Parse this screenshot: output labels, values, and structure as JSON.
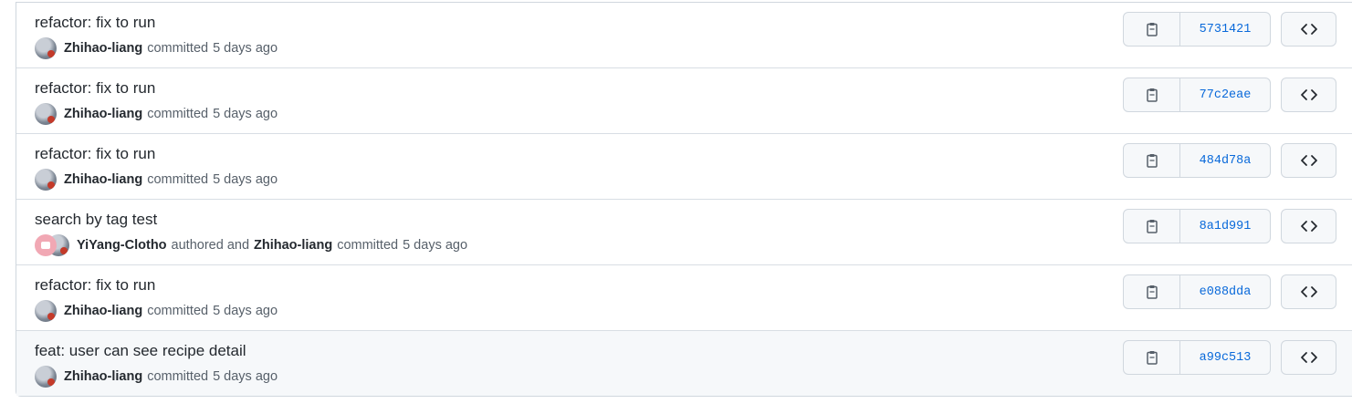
{
  "commits": [
    {
      "title": "refactor: fix to run",
      "author": "Zhihao-liang",
      "action": "committed",
      "time": "5 days ago",
      "sha": "5731421"
    },
    {
      "title": "refactor: fix to run",
      "author": "Zhihao-liang",
      "action": "committed",
      "time": "5 days ago",
      "sha": "77c2eae"
    },
    {
      "title": "refactor: fix to run",
      "author": "Zhihao-liang",
      "action": "committed",
      "time": "5 days ago",
      "sha": "484d78a"
    },
    {
      "title": "search by tag test",
      "co_author": "YiYang-Clotho",
      "co_action": "authored and",
      "author": "Zhihao-liang",
      "action": "committed",
      "time": "5 days ago",
      "sha": "8a1d991"
    },
    {
      "title": "refactor: fix to run",
      "author": "Zhihao-liang",
      "action": "committed",
      "time": "5 days ago",
      "sha": "e088dda"
    },
    {
      "title": "feat: user can see recipe detail",
      "author": "Zhihao-liang",
      "action": "committed",
      "time": "5 days ago",
      "sha": "a99c513"
    }
  ],
  "icons": {
    "copy": "clipboard-icon",
    "browse": "code-icon"
  },
  "colors": {
    "sha_link": "#0969da",
    "highlight_row": "#f6f8fa"
  }
}
